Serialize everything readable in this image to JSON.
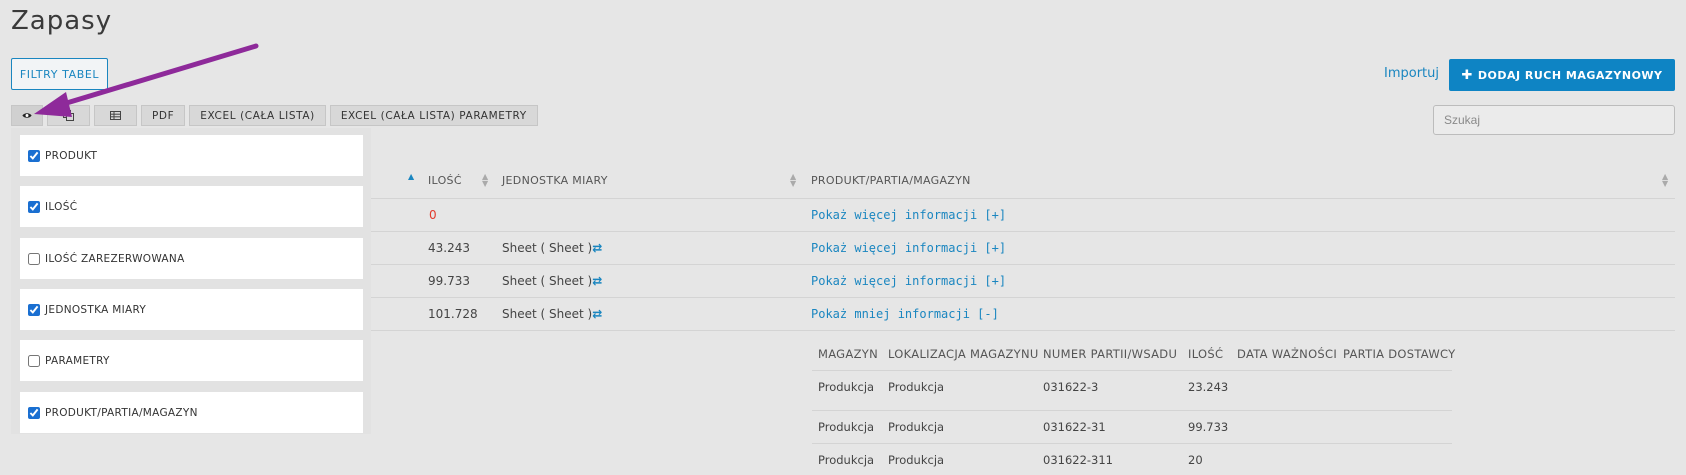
{
  "page": {
    "title": "Zapasy"
  },
  "actions": {
    "filters_label": "FILTRY TABEL",
    "import_label": "Importuj",
    "add_label": "DODAJ RUCH MAGAZYNOWY"
  },
  "search": {
    "placeholder": "Szukaj"
  },
  "toolbar": {
    "pdf": "PDF",
    "excel_all": "EXCEL (CAŁA LISTA)",
    "excel_params": "EXCEL (CAŁA LISTA) PARAMETRY"
  },
  "columns_panel": {
    "items": [
      {
        "label": "PRODUKT",
        "checked": true
      },
      {
        "label": "ILOŚĆ",
        "checked": true
      },
      {
        "label": "ILOŚĆ ZAREZERWOWANA",
        "checked": false
      },
      {
        "label": "JEDNOSTKA MIARY",
        "checked": true
      },
      {
        "label": "PARAMETRY",
        "checked": false
      },
      {
        "label": "PRODUKT/PARTIA/MAGAZYN",
        "checked": true
      }
    ]
  },
  "table": {
    "headers": {
      "qty": "ILOŚĆ",
      "unit": "JEDNOSTKA MIARY",
      "ppm": "PRODUKT/PARTIA/MAGAZYN"
    },
    "rows": [
      {
        "qty": "0",
        "unit": "",
        "link": "Pokaż więcej informacji [+]"
      },
      {
        "qty": "43.243",
        "unit": "Sheet ( Sheet )",
        "link": "Pokaż więcej informacji [+]"
      },
      {
        "qty": "99.733",
        "unit": "Sheet ( Sheet )",
        "link": "Pokaż więcej informacji [+]"
      },
      {
        "qty": "101.728",
        "unit": "Sheet ( Sheet )",
        "link": "Pokaż mniej informacji [-]"
      }
    ]
  },
  "subtable": {
    "headers": {
      "warehouse": "MAGAZYN",
      "location": "LOKALIZACJA MAGAZYNU",
      "batch": "NUMER PARTII/WSADU",
      "qty": "ILOŚĆ",
      "expiry": "DATA WAŻNOŚCI",
      "supplier_batch": "PARTIA DOSTAWCY"
    },
    "rows": [
      {
        "warehouse": "Produkcja",
        "location": "Produkcja",
        "batch": "031622-3",
        "qty": "23.243"
      },
      {
        "warehouse": "Produkcja",
        "location": "Produkcja",
        "batch": "031622-31",
        "qty": "99.733"
      },
      {
        "warehouse": "Produkcja",
        "location": "Produkcja",
        "batch": "031622-311",
        "qty": "20"
      }
    ]
  },
  "colors": {
    "accent": "#0e84c4",
    "link": "#1a86c0",
    "zero": "#e23a2c",
    "annotation_arrow": "#8e2a9a"
  }
}
